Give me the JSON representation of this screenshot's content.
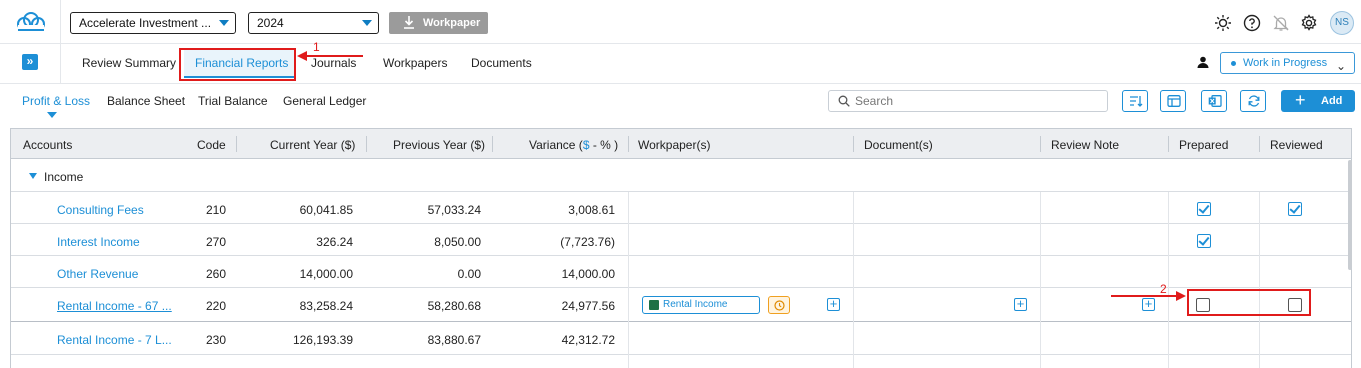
{
  "header": {
    "entity_select": "Accelerate Investment ...",
    "year_select": "2024",
    "workpaper_button": "Workpaper",
    "avatar_initials": "NS",
    "icons": [
      "sun-icon",
      "help-icon",
      "bell-icon",
      "gear-icon"
    ]
  },
  "nav": {
    "tabs": [
      "Review Summary",
      "Financial Reports",
      "Journals",
      "Workpapers",
      "Documents"
    ],
    "active_tab": "Financial Reports",
    "status": "Work in Progress"
  },
  "annotations": {
    "first": "1",
    "second": "2",
    "color": "#e01b1b"
  },
  "subnav": {
    "tabs": [
      "Profit & Loss",
      "Balance Sheet",
      "Trial Balance",
      "General Ledger"
    ],
    "active_tab": "Profit & Loss",
    "search_placeholder": "Search",
    "add_label": "Add"
  },
  "table": {
    "columns": {
      "accounts": "Accounts",
      "code": "Code",
      "current": "Current Year ($)",
      "previous": "Previous Year ($)",
      "variance_prefix": "Variance (",
      "variance_dollar": "$",
      "variance_suffix": " - % )",
      "workpapers": "Workpaper(s)",
      "documents": "Document(s)",
      "review_note": "Review Note",
      "prepared": "Prepared",
      "reviewed": "Reviewed"
    },
    "group": "Income",
    "rows": [
      {
        "account": "Consulting Fees",
        "code": "210",
        "current": "60,041.85",
        "previous": "57,033.24",
        "variance": "3,008.61",
        "prepared": true,
        "reviewed": true
      },
      {
        "account": "Interest Income",
        "code": "270",
        "current": "326.24",
        "previous": "8,050.00",
        "variance": "(7,723.76)",
        "prepared": true,
        "reviewed": false
      },
      {
        "account": "Other Revenue",
        "code": "260",
        "current": "14,000.00",
        "previous": "0.00",
        "variance": "14,000.00",
        "prepared": false,
        "reviewed": false
      },
      {
        "account": "Rental Income - 67 ...",
        "code": "220",
        "current": "83,258.24",
        "previous": "58,280.68",
        "variance": "24,977.56",
        "workpaper": "Rental Income",
        "prepared": false,
        "reviewed": false
      },
      {
        "account": "Rental Income - 7 L...",
        "code": "230",
        "current": "126,193.39",
        "previous": "83,880.67",
        "variance": "42,312.72",
        "prepared": false,
        "reviewed": false
      }
    ]
  },
  "colors": {
    "accent": "#1d8fd6",
    "annotation": "#e01b1b",
    "header_bg": "#eceef1"
  }
}
